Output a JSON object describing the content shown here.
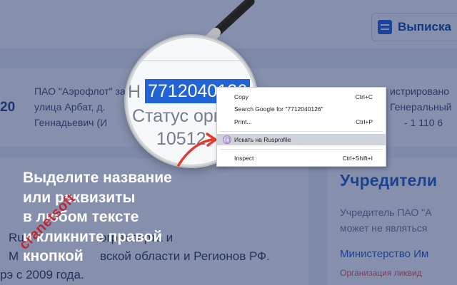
{
  "background": {
    "extract_button": "Выписка",
    "left_number": "20",
    "org_lines": [
      "ПАО \"Аэрофлот\" зарегистрировано",
      "улица Арбат, д.",
      "Геннадьевич (И"
    ],
    "org_lines_right": [
      "истрировано",
      "Генеральный",
      "- 1 110 6"
    ],
    "left_bottom": [
      "Ru",
      "М",
      "рэ с 2009 года."
    ],
    "left_bottom_right": [
      "ограспорта и",
      "вской области и Регионов РФ."
    ],
    "founders_title": "Учредители",
    "founders_text": [
      "Учредитель ПАО \"А",
      "может не являться"
    ],
    "founders_link": "Министерство Им",
    "founders_status": "Организация ликвид"
  },
  "magnifier": {
    "prefix": "Н",
    "selected_text": "7712040126",
    "status_line": "Статус орга",
    "partial_line": "10512"
  },
  "context_menu": {
    "items": [
      {
        "label": "Copy",
        "shortcut": "Ctrl+C"
      },
      {
        "label": "Search Google for \"7712040126\"",
        "shortcut": ""
      },
      {
        "label": "Print...",
        "shortcut": "Ctrl+P"
      },
      {
        "label": "Искать на Rusprofile",
        "shortcut": ""
      },
      {
        "label": "Inspect",
        "shortcut": "Ctrl+Shift+I"
      }
    ]
  },
  "caption": [
    "Выделите название",
    "или реквизиты",
    "в любом тексте",
    "и кликните правой",
    "кнопкой"
  ],
  "watermark": "cranetsoft",
  "colors": {
    "overlay": "#0e225c",
    "selection": "#2264d6",
    "arrow": "#e53a2a",
    "watermark": "#c4161c"
  }
}
